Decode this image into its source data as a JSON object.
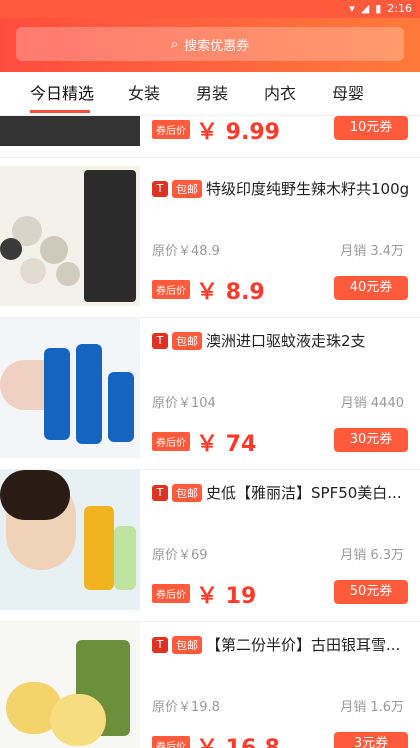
{
  "status": {
    "time": "2:16"
  },
  "header": {
    "search_placeholder": "搜索优惠券"
  },
  "tabs": [
    "今日精选",
    "女装",
    "男装",
    "内衣",
    "母婴"
  ],
  "items": [
    {
      "title": "",
      "badge": "",
      "original_price": "",
      "monthly_sales": "",
      "after_label": "券后价",
      "price": "￥ 9.99",
      "coupon": "10元券"
    },
    {
      "title": "特级印度纯野生辣木籽共100g",
      "badge": "包邮",
      "original_price": "原价￥48.9",
      "monthly_sales": "月销 3.4万",
      "after_label": "券后价",
      "price": "￥ 8.9",
      "coupon": "40元券"
    },
    {
      "title": "澳洲进口驱蚊液走珠2支",
      "badge": "包邮",
      "original_price": "原价￥104",
      "monthly_sales": "月销 4440",
      "after_label": "券后价",
      "price": "￥ 74",
      "coupon": "30元券"
    },
    {
      "title": "史低【雅丽洁】SPF50美白...",
      "badge": "包邮",
      "original_price": "原价￥69",
      "monthly_sales": "月销 6.3万",
      "after_label": "券后价",
      "price": "￥ 19",
      "coupon": "50元券"
    },
    {
      "title": "【第二份半价】古田银耳雪...",
      "badge": "包邮",
      "original_price": "原价￥19.8",
      "monthly_sales": "月销 1.6万",
      "after_label": "券后价",
      "price": "￥ 16.8",
      "coupon": "3元券"
    }
  ]
}
